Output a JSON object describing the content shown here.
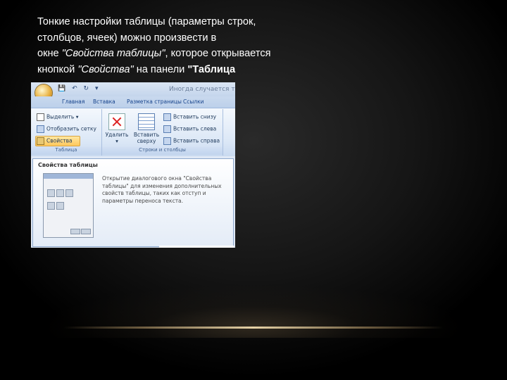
{
  "slide": {
    "lines": [
      {
        "text": "Тонкие настройки таблицы (параметры строк,"
      },
      {
        "text": "столбцов, ячеек) можно произвести в"
      },
      {
        "pre": "окне ",
        "italic": "\"Свойства таблицы\"",
        "post": ", которое открывается"
      },
      {
        "pre": "кнопкой ",
        "italic": "\"Свойства\"",
        "post": " на панели ",
        "bold": "\"Таблица"
      }
    ]
  },
  "word_window": {
    "title": "Иногда случается тся",
    "tabs": [
      "Главная",
      "Вставка",
      "Разметка страницы",
      "Ссылки"
    ],
    "groups": [
      {
        "label": "Таблица"
      },
      {
        "label": "Строки и столбцы"
      }
    ],
    "table_buttons": [
      "Выделить ▾",
      "Отобразить сетку",
      "Свойства"
    ],
    "big_buttons": [
      {
        "line1": "Удалить",
        "line2": "▾"
      },
      {
        "line1": "Вставить",
        "line2": "сверху"
      }
    ],
    "insert_buttons": [
      "Вставить снизу",
      "Вставить слева",
      "Вставить справа"
    ],
    "tooltip": {
      "title": "Свойства таблицы",
      "description": "Открытие диалогового окна \"Свойства таблицы\" для изменения дополнительных свойств таблицы, таких как отступ и параметры переноса текста."
    }
  }
}
